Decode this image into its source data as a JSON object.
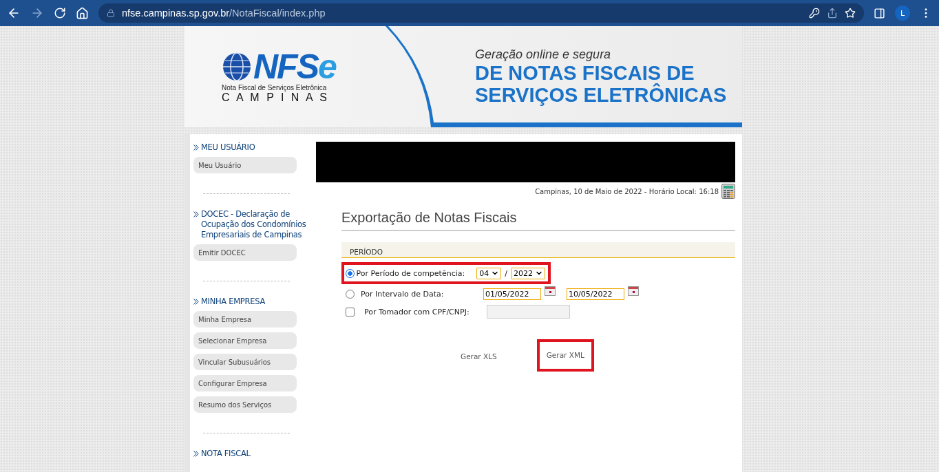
{
  "browser": {
    "url_host": "nfse.campinas.sp.gov.br",
    "url_path": "/NotaFiscal/index.php",
    "profile_initial": "L"
  },
  "header": {
    "logo": {
      "wordmark_dark": "NFS",
      "wordmark_light": "e",
      "subtitle": "Nota Fiscal de Serviços Eletrônica",
      "city": "C A M P I N A S"
    },
    "tagline": "Geração online e segura",
    "title_lines": [
      "DE NOTAS FISCAIS DE",
      "SERVIÇOS ELETRÔNICAS"
    ]
  },
  "sidebar": {
    "sections": [
      {
        "title": "MEU USUÁRIO",
        "items": [
          "Meu Usuário"
        ]
      },
      {
        "title": "DOCEC - Declaração de Ocupação dos Condomínios Empresariais de Campinas",
        "items": [
          "Emitir DOCEC"
        ]
      },
      {
        "title": "MINHA EMPRESA",
        "items": [
          "Minha Empresa",
          "Selecionar Empresa",
          "Vincular Subusuários",
          "Configurar Empresa",
          "Resumo dos Serviços"
        ]
      },
      {
        "title": "NOTA FISCAL"
      }
    ]
  },
  "content": {
    "date_line": "Campinas, 10 de Maio de 2022 - Horário Local: 16:18",
    "heading": "Exportação de Notas Fiscais",
    "section_label": "PERÍODO",
    "options": [
      {
        "kind": "period",
        "label": "Por Período de competência:",
        "selected": true,
        "highlighted": true,
        "month": "04",
        "separator": "/",
        "year": "2022"
      },
      {
        "kind": "date_range",
        "label": "Por Intervalo de Data:",
        "selected": false,
        "highlighted": false,
        "from": "01/05/2022",
        "to": "10/05/2022"
      },
      {
        "kind": "tax_id",
        "label": "Por Tomador com CPF/CNPJ:",
        "checked": false,
        "highlighted": false
      }
    ],
    "buttons": [
      {
        "label": "Gerar XLS",
        "highlighted": false
      },
      {
        "label": "Gerar XML",
        "highlighted": true
      }
    ]
  }
}
